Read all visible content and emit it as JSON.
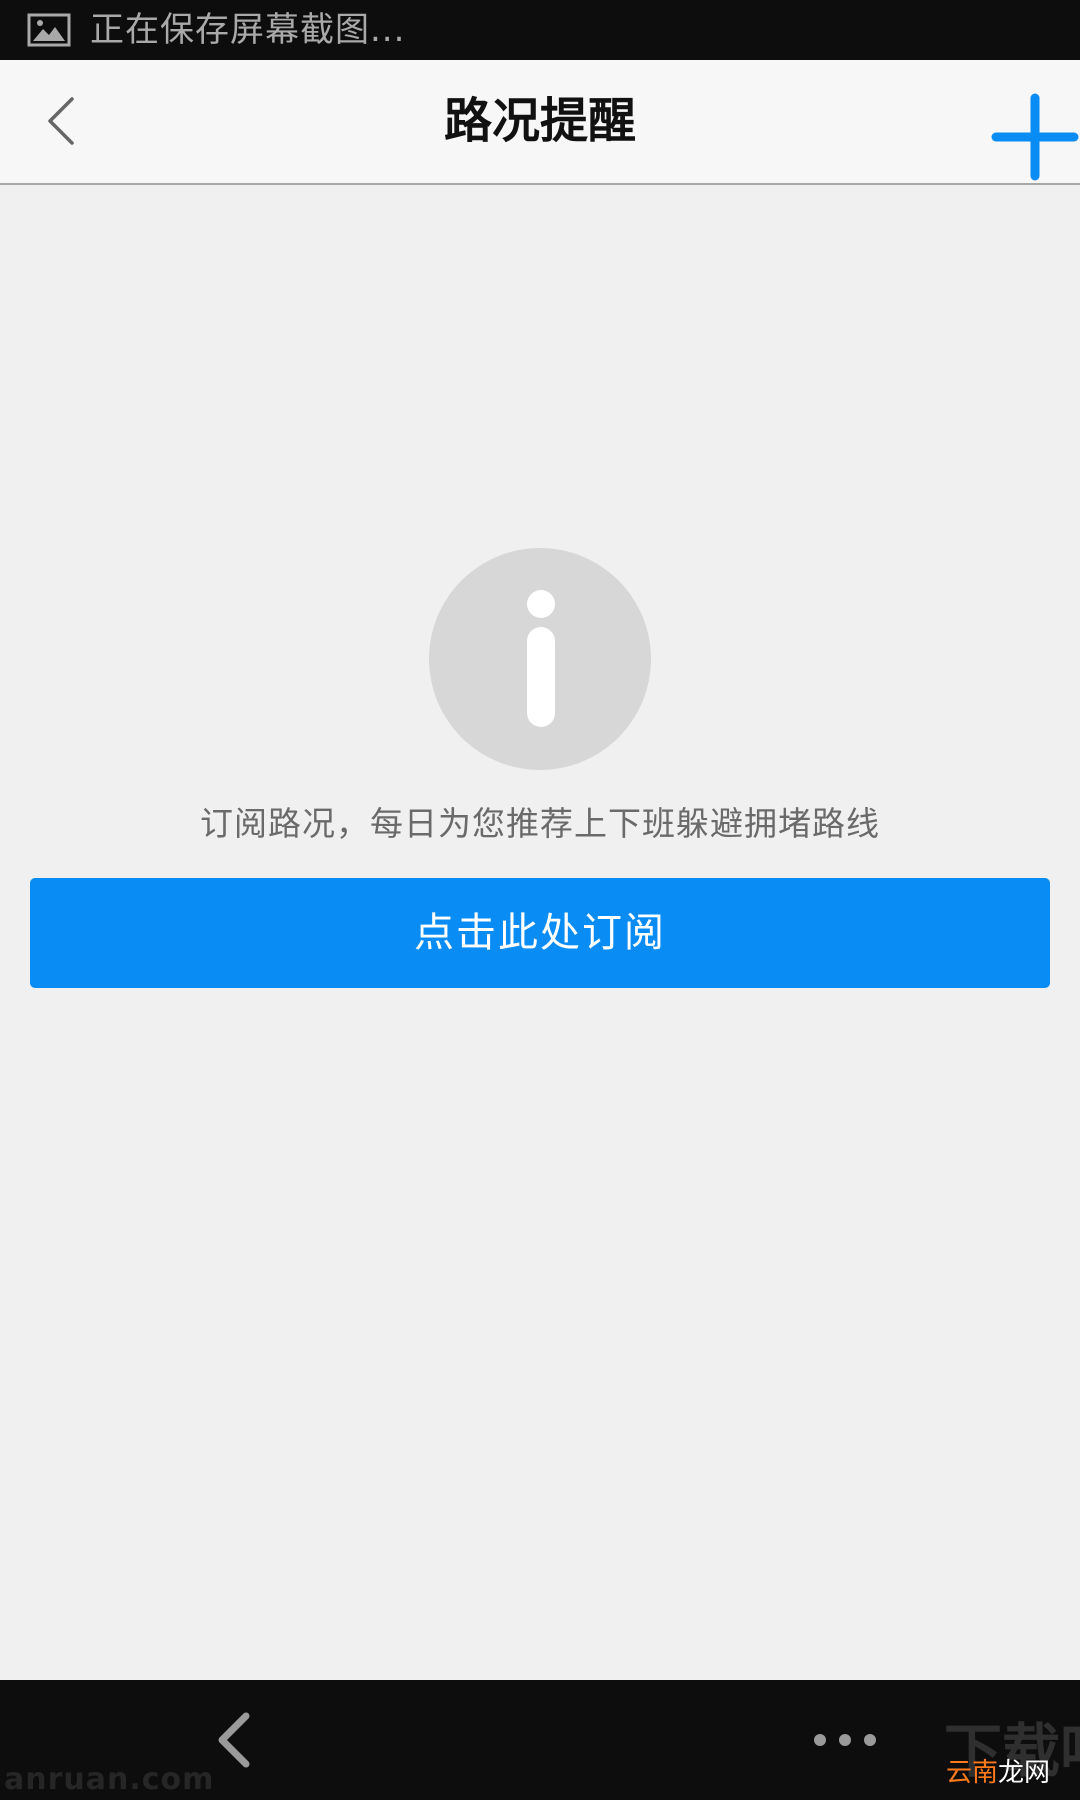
{
  "status_bar": {
    "text": "正在保存屏幕截图..."
  },
  "header": {
    "title": "路况提醒"
  },
  "empty_state": {
    "hint": "订阅路况，每日为您推荐上下班躲避拥堵路线",
    "subscribe_label": "点击此处订阅"
  },
  "watermark": {
    "left": "anruan.com",
    "right_big": "下载吧",
    "right_accent": "云南",
    "right_text": "龙网"
  },
  "colors": {
    "accent": "#0a8cf5",
    "status_bar_bg": "#0d0d0d",
    "page_bg": "#f0f0f0"
  },
  "icons": {
    "status": "image-icon",
    "back": "chevron-left-icon",
    "add": "plus-icon",
    "info": "info-icon",
    "nav_back": "chevron-left-icon",
    "nav_more": "more-dots-icon"
  }
}
